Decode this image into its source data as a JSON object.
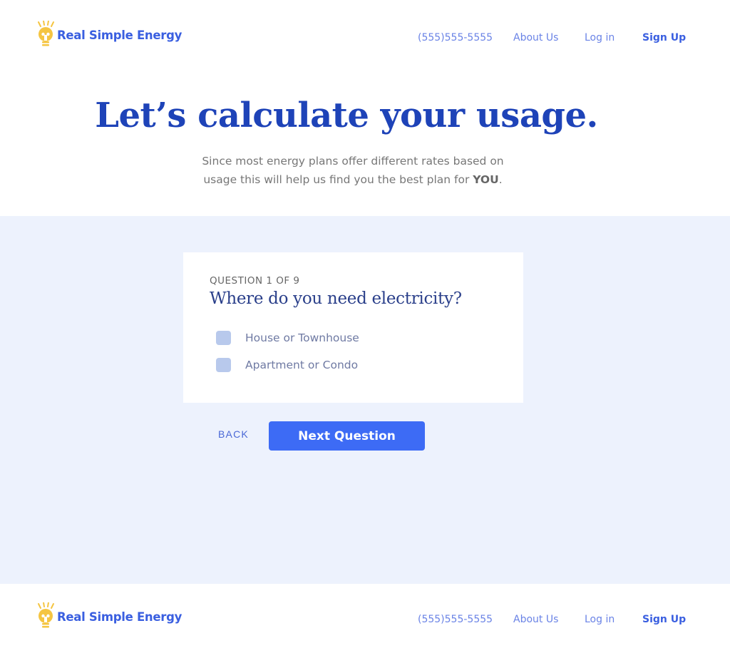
{
  "brand": {
    "name": "Real Simple Energy",
    "icon": "lightbulb-icon",
    "color": "#3a5fe0",
    "icon_color": "#f5c542"
  },
  "nav": {
    "phone": "(555)555-5555",
    "about": "About Us",
    "login": "Log in",
    "signup": "Sign Up"
  },
  "hero": {
    "title": "Let’s calculate your usage.",
    "subtitle_line1": "Since most energy plans offer different rates based on",
    "subtitle_line2": "usage this will help us find you the best plan for",
    "subtitle_emphasis": "YOU",
    "subtitle_end": "."
  },
  "quiz": {
    "counter": "QUESTION 1 OF 9",
    "question": "Where do you need electricity?",
    "options": [
      {
        "label": "House or Townhouse",
        "checked": false
      },
      {
        "label": "Apartment or Condo",
        "checked": false
      }
    ],
    "back_label": "BACK",
    "next_label": "Next Question"
  },
  "footer": {
    "brand_name": "Real Simple Energy",
    "phone": "(555)555-5555",
    "about": "About Us",
    "login": "Log in",
    "signup": "Sign Up"
  },
  "colors": {
    "accent": "#3d6bf5",
    "title": "#1e43b8",
    "band": "#edf2fd"
  }
}
